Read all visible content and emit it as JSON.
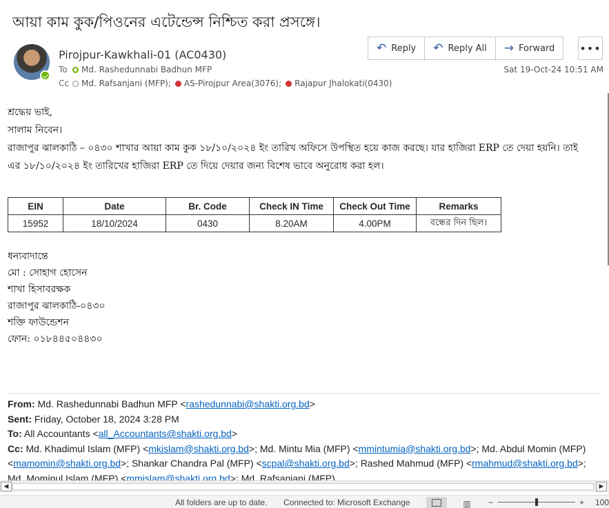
{
  "message": {
    "subject": "আয়া কাম কুক/পিওনের এটেন্ডেন্স নিশ্চিত করা প্রসঙ্গে।",
    "sender": "Pirojpur-Kawkhali-01 (AC0430)",
    "to_label": "To",
    "to": "Md. Rashedunnabi Badhun MFP",
    "cc_label": "Cc",
    "cc": [
      {
        "name": "Md. Rafsanjani (MFP);",
        "status": "empty"
      },
      {
        "name": "AS-Pirojpur Area(3076);",
        "status": "red"
      },
      {
        "name": "Rajapur Jhalokati(0430)",
        "status": "red"
      }
    ],
    "date": "Sat 19-Oct-24 10:51 AM"
  },
  "actions": {
    "reply": "Reply",
    "reply_all": "Reply All",
    "forward": "Forward",
    "more": "•••"
  },
  "body": {
    "greeting": "শ্রদ্ধেয় ভাই,",
    "salam": "সালাম নিবেন।",
    "paragraph_line1": "রাজাপুর ঝালকাঠি – ০৪৩০ শাখার আয়া কাম কুক ১৮/১০/২০২৪ ইং তারিখ অফিসে উপস্থিত হয়ে কাজ করছে। যার হাজিরা ERP তে দেয়া হয়নি। তাই",
    "paragraph_line2": "এর ১৮/১০/২০২৪ ইং তারিখের হাজিরা ERP তে দিয়ে দেয়ার জন্য বিশেষ ভাবে অনুরোধ করা হল।"
  },
  "table": {
    "headers": [
      "EIN",
      "Date",
      "Br. Code",
      "Check IN Time",
      "Check Out Time",
      "Remarks"
    ],
    "row": [
      "15952",
      "18/10/2024",
      "0430",
      "8.20AM",
      "4.00PM",
      "বন্ধের দিন ছিল।"
    ]
  },
  "signature": {
    "thanks": "ধন্যবাদান্তে",
    "name": "মো : সোহাগ হোসেন",
    "designation": "শাখা হিসাবরক্ষক",
    "branch": "রাজাপুর ঝালকাঠি-০৪৩০",
    "org": "শক্তি ফাউন্ডেশন",
    "phone": "ফোন: ০১৮৪৪৫০৪৪৩০"
  },
  "forwarded": {
    "from_label": "From:",
    "from_name": " Md. Rashedunnabi Badhun MFP <",
    "from_email": "rashedunnabi@shakti.org.bd",
    "from_close": ">",
    "sent_label": "Sent:",
    "sent": " Friday, October 18, 2024 3:28 PM",
    "to_label": "To:",
    "to_name": " All Accountants <",
    "to_email": "all_Accountants@shakti.org.bd",
    "to_close": ">",
    "cc_label": "Cc:",
    "cc_1": " Md. Khadimul Islam (MFP) <",
    "cc_1_email": "mkislam@shakti.org.bd",
    "cc_2": ">; Md. Mintu Mia (MFP) <",
    "cc_2_email": "mmintumia@shakti.org.bd",
    "cc_3": ">; Md. Abdul Momin (MFP) <",
    "cc_3_email": "mamomin@shakti.org.bd",
    "cc_4": ">; Shankar Chandra Pal (MFP) <",
    "cc_4_email": "scpal@shakti.org.bd",
    "cc_5": ">; Rashed Mahmud (MFP) <",
    "cc_5_email": "rmahmud@shakti.org.bd",
    "cc_6": ">; Md. Mominul Islam (MFP) <",
    "cc_6_email": "mmislam@shakti.org.bd",
    "cc_7": ">; Md. Rafsanjani (MFP)"
  },
  "statusbar": {
    "sync": "All folders are up to date.",
    "connection": "Connected to: Microsoft Exchange",
    "zoom": "100",
    "minus": "−",
    "plus": "+"
  },
  "colors": {
    "accent": "#2b579a",
    "presence_available": "#6bb700",
    "presence_busy": "#d13438",
    "link": "#0563c1"
  }
}
